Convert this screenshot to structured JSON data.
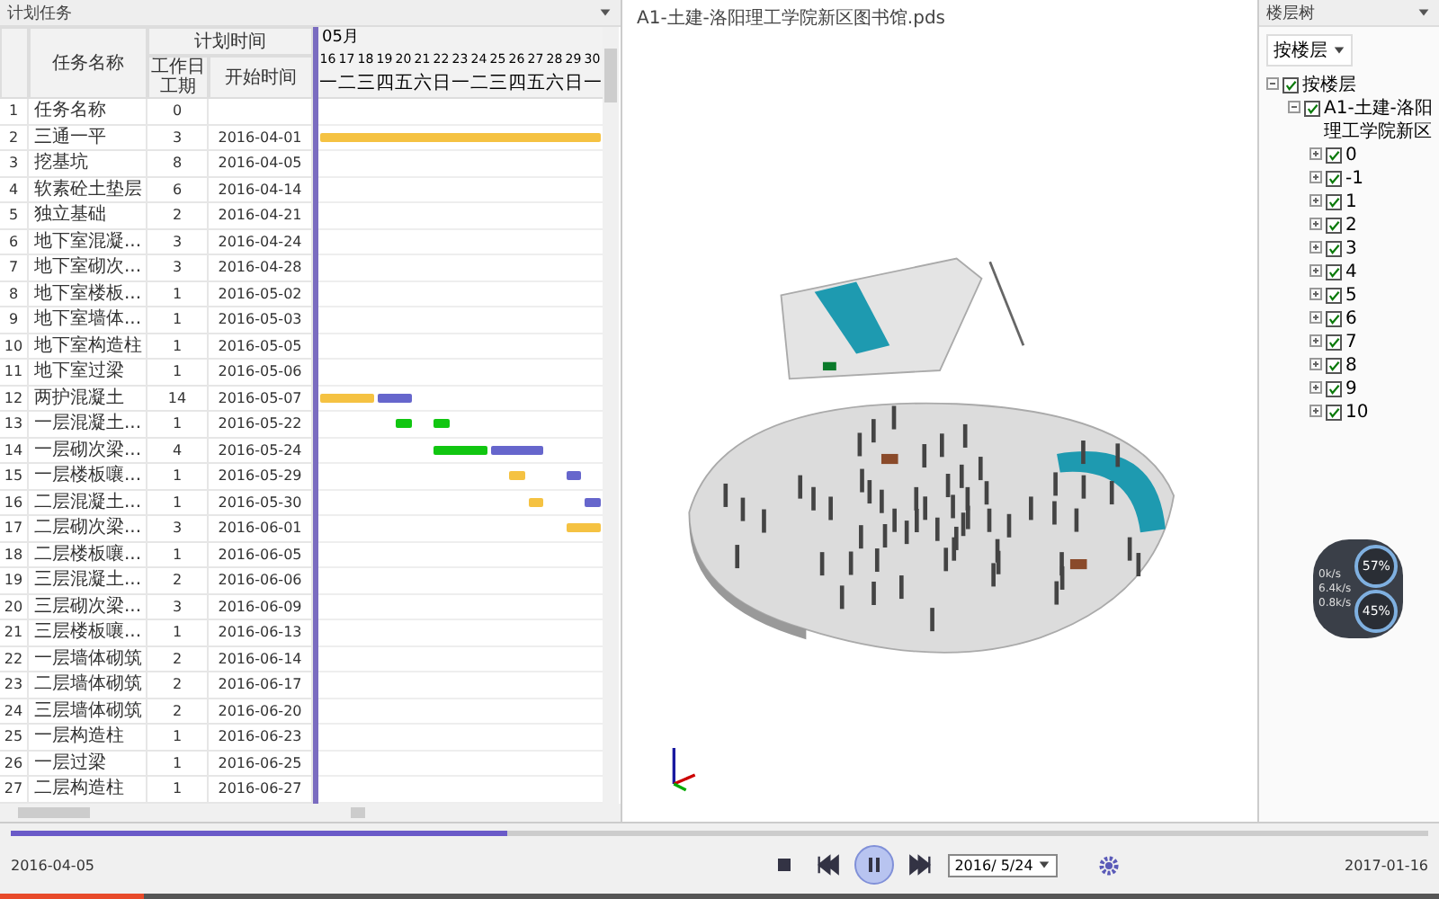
{
  "plan_panel": {
    "title": "计划任务",
    "columns": {
      "name": "任务名称",
      "group": "计划时间",
      "duration": "工作日工期",
      "start": "开始时间"
    },
    "gantt": {
      "month": "05月",
      "days": [
        {
          "date": "16",
          "weekday": "一"
        },
        {
          "date": "17",
          "weekday": "二"
        },
        {
          "date": "18",
          "weekday": "三"
        },
        {
          "date": "19",
          "weekday": "四"
        },
        {
          "date": "20",
          "weekday": "五"
        },
        {
          "date": "21",
          "weekday": "六"
        },
        {
          "date": "22",
          "weekday": "日"
        },
        {
          "date": "23",
          "weekday": "一"
        },
        {
          "date": "24",
          "weekday": "二"
        },
        {
          "date": "25",
          "weekday": "三"
        },
        {
          "date": "26",
          "weekday": "四"
        },
        {
          "date": "27",
          "weekday": "五"
        },
        {
          "date": "28",
          "weekday": "六"
        },
        {
          "date": "29",
          "weekday": "日"
        },
        {
          "date": "30",
          "weekday": "一"
        }
      ]
    },
    "rows": [
      {
        "no": "1",
        "name": "任务名称",
        "duration": "0"
      },
      {
        "no": "2",
        "name": "三通一平",
        "duration": "3",
        "start": "2016-04-01"
      },
      {
        "no": "3",
        "name": "挖基坑",
        "duration": "8",
        "start": "2016-04-05"
      },
      {
        "no": "4",
        "name": "软素砼土垫层",
        "duration": "6",
        "start": "2016-04-14"
      },
      {
        "no": "5",
        "name": "独立基础",
        "duration": "2",
        "start": "2016-04-21"
      },
      {
        "no": "6",
        "name": "地下室混凝...",
        "duration": "3",
        "start": "2016-04-24"
      },
      {
        "no": "7",
        "name": "地下室砌次...",
        "duration": "3",
        "start": "2016-04-28"
      },
      {
        "no": "8",
        "name": "地下室楼板...",
        "duration": "1",
        "start": "2016-05-02"
      },
      {
        "no": "9",
        "name": "地下室墙体...",
        "duration": "1",
        "start": "2016-05-03"
      },
      {
        "no": "10",
        "name": "地下室构造柱",
        "duration": "1",
        "start": "2016-05-05"
      },
      {
        "no": "11",
        "name": "地下室过梁",
        "duration": "1",
        "start": "2016-05-06"
      },
      {
        "no": "12",
        "name": "两护混凝土",
        "duration": "14",
        "start": "2016-05-07"
      },
      {
        "no": "13",
        "name": "一层混凝土...",
        "duration": "1",
        "start": "2016-05-22"
      },
      {
        "no": "14",
        "name": "一层砌次梁...",
        "duration": "4",
        "start": "2016-05-24"
      },
      {
        "no": "15",
        "name": "一层楼板嚷...",
        "duration": "1",
        "start": "2016-05-29"
      },
      {
        "no": "16",
        "name": "二层混凝土...",
        "duration": "1",
        "start": "2016-05-30"
      },
      {
        "no": "17",
        "name": "二层砌次梁...",
        "duration": "3",
        "start": "2016-06-01"
      },
      {
        "no": "18",
        "name": "二层楼板嚷...",
        "duration": "1",
        "start": "2016-06-05"
      },
      {
        "no": "19",
        "name": "三层混凝土...",
        "duration": "2",
        "start": "2016-06-06"
      },
      {
        "no": "20",
        "name": "三层砌次梁...",
        "duration": "3",
        "start": "2016-06-09"
      },
      {
        "no": "21",
        "name": "三层楼板嚷...",
        "duration": "1",
        "start": "2016-06-13"
      },
      {
        "no": "22",
        "name": "一层墙体砌筑",
        "duration": "2",
        "start": "2016-06-14"
      },
      {
        "no": "23",
        "name": "二层墙体砌筑",
        "duration": "2",
        "start": "2016-06-17"
      },
      {
        "no": "24",
        "name": "三层墙体砌筑",
        "duration": "2",
        "start": "2016-06-20"
      },
      {
        "no": "25",
        "name": "一层构造柱",
        "duration": "1",
        "start": "2016-06-23"
      },
      {
        "no": "26",
        "name": "一层过梁",
        "duration": "1",
        "start": "2016-06-25"
      },
      {
        "no": "27",
        "name": "二层构造柱",
        "duration": "1",
        "start": "2016-06-27"
      }
    ]
  },
  "viewer": {
    "title": "A1-土建-洛阳理工学院新区图书馆.pds"
  },
  "tree_panel": {
    "title": "楼层树",
    "mode": "按楼层",
    "tree": [
      {
        "label": "按楼层",
        "checked": true,
        "expanded": true,
        "children": [
          {
            "label": "A1-土建-洛阳理工学院新区",
            "checked": true,
            "expanded": true,
            "children": [
              {
                "label": "0",
                "checked": true,
                "expanded": false
              },
              {
                "label": "-1",
                "checked": true,
                "expanded": false
              },
              {
                "label": "1",
                "checked": true,
                "expanded": false
              },
              {
                "label": "2",
                "checked": true,
                "expanded": false
              },
              {
                "label": "3",
                "checked": true,
                "expanded": false
              },
              {
                "label": "4",
                "checked": true,
                "expanded": false
              },
              {
                "label": "5",
                "checked": true,
                "expanded": false
              },
              {
                "label": "6",
                "checked": true,
                "expanded": false
              },
              {
                "label": "7",
                "checked": true,
                "expanded": false
              },
              {
                "label": "8",
                "checked": true,
                "expanded": false
              },
              {
                "label": "9",
                "checked": true,
                "expanded": false
              },
              {
                "label": "10",
                "checked": true,
                "expanded": false
              }
            ]
          }
        ]
      }
    ]
  },
  "monitor": {
    "cpu": "57%",
    "memory": "45%",
    "speeds": [
      "0k/s",
      "6.4k/s",
      "0.8k/s"
    ]
  },
  "playback": {
    "timeline": {
      "level": 0.35
    },
    "start_date": "2016-04-05",
    "end_date": "2017-01-16",
    "controls": [
      {
        "kind": "stop",
        "selected": false
      },
      {
        "kind": "previous",
        "selected": false
      },
      {
        "kind": "pause",
        "selected": true
      },
      {
        "kind": "next",
        "selected": false
      }
    ],
    "current_date": "2016/ 5/24",
    "progress": {
      "level": 0.1
    }
  }
}
